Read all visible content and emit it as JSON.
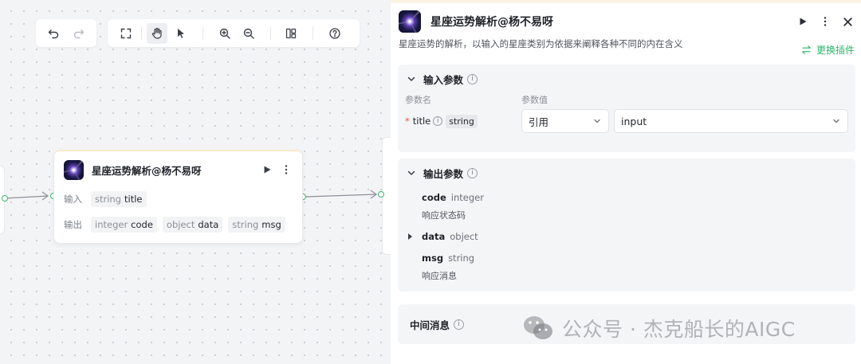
{
  "toolbar": {
    "undo": "undo-icon",
    "redo": "redo-icon",
    "fit": "fit-view-icon",
    "hand": "hand-icon",
    "pointer": "pointer-icon",
    "zoom_in": "zoom-in-icon",
    "zoom_out": "zoom-out-icon",
    "layout": "layout-icon",
    "help": "help-icon"
  },
  "node": {
    "title": "星座运势解析@杨不易呀",
    "input_label": "输入",
    "output_label": "输出",
    "inputs": [
      {
        "type": "string",
        "name": "title"
      }
    ],
    "outputs": [
      {
        "type": "integer",
        "name": "code"
      },
      {
        "type": "object",
        "name": "data"
      },
      {
        "type": "string",
        "name": "msg"
      }
    ]
  },
  "panel": {
    "title": "星座运势解析@杨不易呀",
    "description": "星座运势的解析，以输入的星座类别为依据来阐释各种不同的内在含义",
    "change_plugin": "更换插件",
    "input_section": {
      "title": "输入参数",
      "col_name": "参数名",
      "col_value": "参数值",
      "param": {
        "required_mark": "*",
        "name": "title",
        "type": "string",
        "mode": "引用",
        "value": "input"
      }
    },
    "output_section": {
      "title": "输出参数",
      "items": [
        {
          "name": "code",
          "type": "integer",
          "desc": "响应状态码"
        },
        {
          "name": "data",
          "type": "object",
          "desc": ""
        },
        {
          "name": "msg",
          "type": "string",
          "desc": "响应消息"
        }
      ]
    },
    "middle_section": {
      "title": "中间消息"
    }
  },
  "watermark": {
    "text": "公众号 · 杰克船长的AIGC"
  },
  "colors": {
    "accent_green": "#2bb468",
    "port_green": "#3fb56d",
    "required_red": "#f5543d"
  }
}
